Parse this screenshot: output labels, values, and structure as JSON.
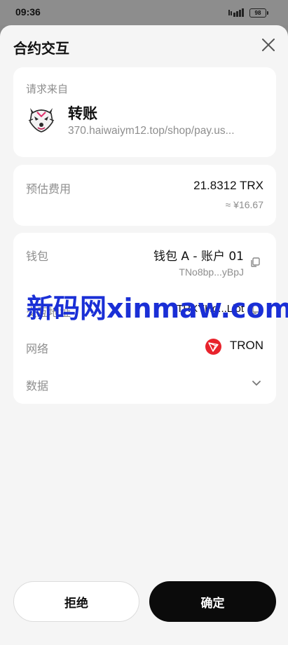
{
  "status_bar": {
    "time": "09:36",
    "battery": "98"
  },
  "sheet": {
    "title": "合约交互"
  },
  "request": {
    "label": "请求来自",
    "dapp_name": "转账",
    "url": "370.haiwaiym12.top/shop/pay.us..."
  },
  "fee": {
    "label": "预估费用",
    "value": "21.8312 TRX",
    "fiat": "≈ ¥16.67"
  },
  "details": {
    "wallet_label": "钱包",
    "wallet_name": "钱包 A - 账户 01",
    "wallet_address": "TNo8bp...yBpJ",
    "to_label": "交互地址",
    "to_address": "TRXYHq...Ljot",
    "network_label": "网络",
    "network_name": "TRON",
    "data_label": "数据"
  },
  "watermark": "新码网xinmaw.com",
  "buttons": {
    "reject": "拒绝",
    "confirm": "确定"
  },
  "colors": {
    "tron_red": "#e8232c",
    "watermark_blue": "#1a2fd6",
    "confirm_bg": "#0b0b0b"
  }
}
